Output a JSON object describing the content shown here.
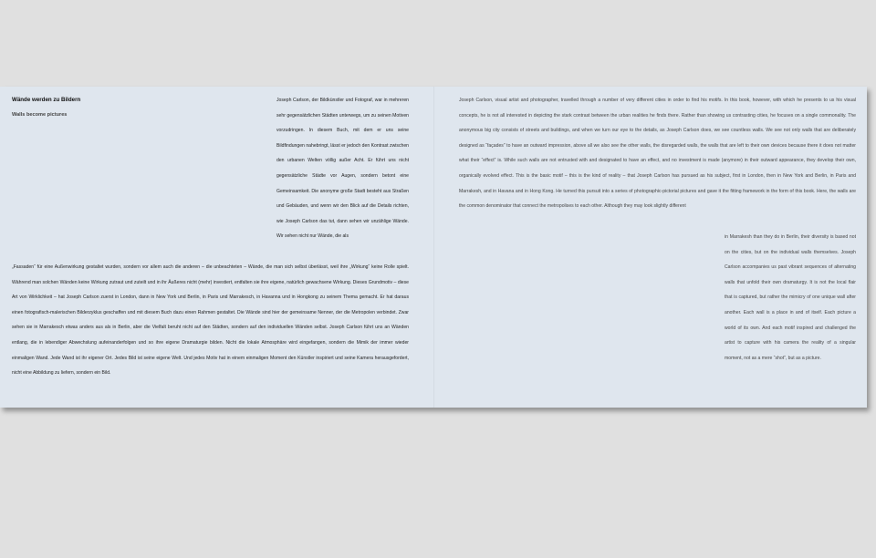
{
  "book": {
    "title_de": "Wände werden zu Bildern",
    "title_en": "Walls become pictures"
  },
  "german_text": {
    "part1": "Joseph Carlson, der Bildkünstler und Fotograf, war in mehreren sehr gegensätzlichen Städten unterwegs, um zu seinen Motiven vorzudringen. In diesem Buch, mit dem er uns seine Bildfindungen nahebringt, lässt er jedoch den Kontrast zwischen den urbanen Welten völlig außer Acht. Er führt uns nicht gegensätzliche Städte vor Augen, sondern betont eine Gemeinsamkeit. Die anonyme große Stadt besteht aus Straßen und Gebäuden, und wenn wir den Blick auf die Details richten, wie Joseph Carlson das tut, dann sehen wir unzählige Wände. Wir sehen nicht nur Wände, die als",
    "part2": "„Fassaden“ für eine Außenwirkung gestaltet wurden, sondern vor allem auch die anderen – die unbeachteten – Wände, die man sich selbst überlässt, weil ihre „Wirkung“ keine Rolle spielt. Während man solchen Wänden keine Wirkung zutraut und zuteilt und in ihr Äußeres nicht (mehr) investiert, entfalten sie ihre eigene, natürlich gewachsene Wirkung. Dieses Grundmotiv – diese Art von Wirklichkeit – hat Joseph Carlson zuerst in London, dann in New York und Berlin, in Paris und Marrakesch, in Havanna und in Hongkong zu seinem Thema gemacht. Er hat daraus einen fotografisch-malerischen Bilderzyklus geschaffen und mit diesem Buch dazu einen Rahmen gestaltet. Die Wände sind hier der gemeinsame Nenner, der die Metropolen verbindet. Zwar sehen sie in Marrakesch etwas anders aus als in Berlin, aber die Vielfalt beruht nicht auf den Städten, sondern auf den individuellen Wänden selbst. Joseph Carlson führt uns an Wänden entlang, die in lebendiger Abwechslung aufeinanderfolgen und so ihre eigene Dramaturgie bilden. Nicht die lokale Atmosphäre wird eingefangen, sondern die Mimik der immer wieder einmaligen Wand. Jede Wand ist ihr eigener Ort. Jedes Bild ist seine eigene Welt. Und jedes Motiv hat in einem einmaligen Moment den Künstler inspiriert und seine Kamera herausgefordert, nicht eine Abbildung zu liefern, sondern ein Bild."
  },
  "english_text": {
    "part1": "Joseph Carlson, visual artist and photographer, travelled through a number of very different cities in order to find his motifs. In this book, however, with which he presents to us his visual concepts, he is not all interested in depicting the stark contrast between the urban realities he finds there. Rather than showing us contrasting cities, he focuses on a single commonality. The anonymous big city consists of streets and buildings, and when we turn our eye to the details, as Joseph Carlson does, we see countless walls. We see not only walls that are deliberately designed as “façades” to have an outward impression, above all we also see the other walls, the disregarded walls, the walls that are left to their own devices because there it does not matter what their “effect” is. While such walls are not entrusted with and designated to have an effect, and no investment is made (anymore) in their outward appearance, they develop their own, organically evolved effect. This is the basic motif – this is the kind of reality – that Joseph Carlson has pursued as his subject, first in London, then in New York and Berlin, in Paris and Marrakesh, and in Havana and in Hong Kong. He turned this pursuit into a series of photographic-pictorial pictures and gave it the fitting framework in the form of this book. Here, the walls are the common denominator that connect the metropolises to each other. Although they may look slightly different",
    "part2": "in Marrakesh than they do in Berlin, their diversity is based not on the cities, but on the individual walls themselves. Joseph Carlson accompanies us past vibrant sequences of alternating walls that unfold their own dramaturgy. It is not the local flair that is captured, but rather the mimicry of one unique wall after another. Each wall is a place in and of itself. Each picture a world of its own. And each motif inspired and challenged the artist to capture with his camera the reality of a singular moment, not as a mere “shot”, but as a picture."
  }
}
